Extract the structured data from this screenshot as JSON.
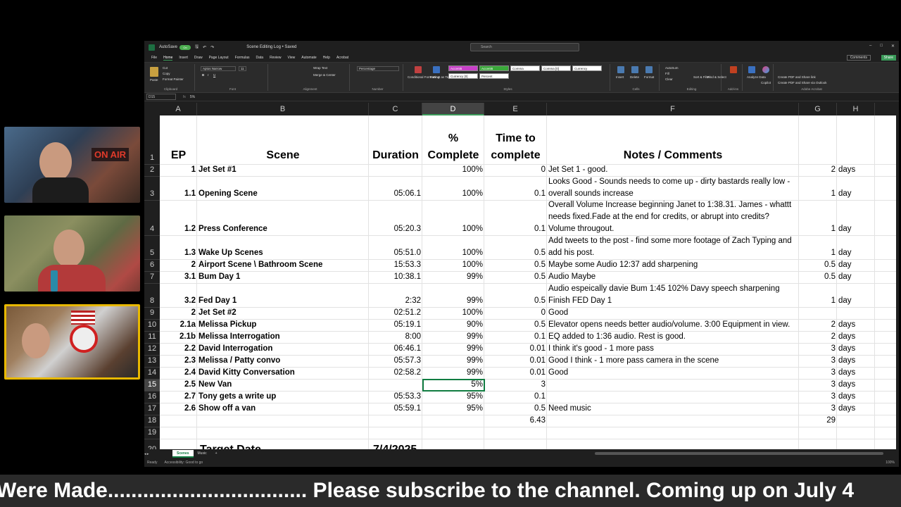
{
  "window": {
    "autosave_label": "AutoSave",
    "autosave_state": "On",
    "doc_title": "Scene Editing Log • Saved",
    "search_placeholder": "Search",
    "comments_label": "Comments",
    "share_label": "Share"
  },
  "menu": [
    "File",
    "Home",
    "Insert",
    "Draw",
    "Page Layout",
    "Formulas",
    "Data",
    "Review",
    "View",
    "Automate",
    "Help",
    "Acrobat"
  ],
  "ribbon": {
    "paste": "Paste",
    "cut": "Cut",
    "copy": "Copy",
    "format_painter": "Format Painter",
    "clipboard": "Clipboard",
    "font_name": "Aptos Narrow",
    "font_size": "11",
    "font": "Font",
    "wrap_text": "Wrap Text",
    "merge_center": "Merge & Center",
    "alignment": "Alignment",
    "number_format": "Percentage",
    "number": "Number",
    "conditional": "Conditional Formatting",
    "format_table": "Format as Table",
    "styles": "Styles",
    "style_cells": [
      "Accent6",
      "Accent6",
      "Comma",
      "Comma [0]",
      "Currency",
      "Currency [0]",
      "Percent"
    ],
    "insert": "Insert",
    "delete": "Delete",
    "format": "Format",
    "cells": "Cells",
    "autosum": "AutoSum",
    "fill": "Fill",
    "clear": "Clear",
    "sort_filter": "Sort & Filter",
    "find_select": "Find & Select",
    "editing": "Editing",
    "addins": "Add-ins",
    "analyze": "Analyze Data",
    "copilot": "Copilot",
    "create_pdf": "Create PDF and Share link",
    "create_pdf_outlook": "Create PDF and Share via Outlook",
    "adobe": "Adobe Acrobat"
  },
  "formula": {
    "namebox": "D15",
    "fx": "fx",
    "value": "5%"
  },
  "columns": [
    "A",
    "B",
    "C",
    "D",
    "E",
    "F",
    "G",
    "H"
  ],
  "headers": {
    "ep": "EP",
    "scene": "Scene",
    "duration": "Duration",
    "pct_line1": "%",
    "pct_line2": "Complete",
    "time_line1": "Time to",
    "time_line2": "complete",
    "notes": "Notes / Comments"
  },
  "rows": [
    {
      "num": "2",
      "ep": "1",
      "scene": "Jet Set #1",
      "duration": "",
      "pct": "100%",
      "time": "0",
      "notes": "Jet Set 1 - good.",
      "g": "2",
      "h": "days"
    },
    {
      "num": "3",
      "ep": "1.1",
      "scene": "Opening Scene",
      "duration": "05:06.1",
      "pct": "100%",
      "time": "0.1",
      "notes": "Looks Good - Sounds needs to come up - dirty bastards really low - overall sounds increase",
      "g": "1",
      "h": "day"
    },
    {
      "num": "4",
      "ep": "1.2",
      "scene": "Press Conference",
      "duration": "05:20.3",
      "pct": "100%",
      "time": "0.1",
      "notes": "Overall Volume Increase beginning Janet to 1:38.31. James - whattt needs fixed.Fade at the end for credits, or abrupt into credits? Volume througout.",
      "g": "1",
      "h": "day"
    },
    {
      "num": "5",
      "ep": "1.3",
      "scene": "Wake Up Scenes",
      "duration": "05:51.0",
      "pct": "100%",
      "time": "0.5",
      "notes": "Add tweets to the post - find some more footage of Zach Typing and add his post.",
      "g": "1",
      "h": "day"
    },
    {
      "num": "6",
      "ep": "2",
      "scene": "Airport Scene \\ Bathroom Scene",
      "duration": "15:53.3",
      "pct": "100%",
      "time": "0.5",
      "notes": "Maybe some Audio 12:37 add sharpening",
      "g": "0.5",
      "h": "day"
    },
    {
      "num": "7",
      "ep": "3.1",
      "scene": "Bum Day 1",
      "duration": "10:38.1",
      "pct": "99%",
      "time": "0.5",
      "notes": "Audio Maybe",
      "g": "0.5",
      "h": "day"
    },
    {
      "num": "8",
      "ep": "3.2",
      "scene": "Fed Day 1",
      "duration": "2:32",
      "pct": "99%",
      "time": "0.5",
      "notes": "Audio espeically davie Bum 1:45 102% Davy speech sharpening Finish FED Day 1",
      "g": "1",
      "h": "day"
    },
    {
      "num": "9",
      "ep": "2",
      "scene": "Jet Set #2",
      "duration": "02:51.2",
      "pct": "100%",
      "time": "0",
      "notes": "Good",
      "g": "",
      "h": ""
    },
    {
      "num": "10",
      "ep": "2.1a",
      "scene": "Melissa Pickup",
      "duration": "05:19.1",
      "pct": "90%",
      "time": "0.5",
      "notes": "Elevator opens needs better audio/volume. 3:00 Equipment in view.",
      "g": "2",
      "h": "days"
    },
    {
      "num": "11",
      "ep": "2.1b",
      "scene": "Melissa Interrogation",
      "duration": "8:00",
      "pct": "99%",
      "time": "0.1",
      "notes": "EQ added to 1:36 audio. Rest is good.",
      "g": "2",
      "h": "days"
    },
    {
      "num": "12",
      "ep": "2.2",
      "scene": "David Interrogation",
      "duration": "06:46.1",
      "pct": "99%",
      "time": "0.01",
      "notes": "I think it's good - 1 more pass",
      "g": "3",
      "h": "days"
    },
    {
      "num": "13",
      "ep": "2.3",
      "scene": "Melissa / Patty convo",
      "duration": "05:57.3",
      "pct": "99%",
      "time": "0.01",
      "notes": "Good I think - 1 more pass camera in the scene",
      "g": "3",
      "h": "days"
    },
    {
      "num": "14",
      "ep": "2.4",
      "scene": "David Kitty Conversation",
      "duration": "02:58.2",
      "pct": "99%",
      "time": "0.01",
      "notes": "Good",
      "g": "3",
      "h": "days"
    },
    {
      "num": "15",
      "ep": "2.5",
      "scene": "New Van",
      "duration": "",
      "pct": "5%",
      "time": "3",
      "notes": "",
      "g": "3",
      "h": "days"
    },
    {
      "num": "16",
      "ep": "2.7",
      "scene": "Tony gets a write up",
      "duration": "05:53.3",
      "pct": "95%",
      "time": "0.1",
      "notes": "",
      "g": "3",
      "h": "days"
    },
    {
      "num": "17",
      "ep": "2.6",
      "scene": "Show off a van",
      "duration": "05:59.1",
      "pct": "95%",
      "time": "0.5",
      "notes": "Need music",
      "g": "3",
      "h": "days"
    },
    {
      "num": "18",
      "ep": "",
      "scene": "",
      "duration": "",
      "pct": "",
      "time": "6.43",
      "notes": "",
      "g": "29",
      "h": ""
    },
    {
      "num": "19",
      "ep": "",
      "scene": "",
      "duration": "",
      "pct": "",
      "time": "",
      "notes": "",
      "g": "",
      "h": ""
    },
    {
      "num": "20",
      "ep": "",
      "scene": "Target Date",
      "duration": "7/4/2025",
      "pct": "",
      "time": "",
      "notes": "",
      "g": "",
      "h": ""
    }
  ],
  "sheets": [
    "Scenes",
    "Music"
  ],
  "status": {
    "ready": "Ready",
    "accessibility": "Accessibility: Good to go",
    "zoom": "100%"
  },
  "overlay": {
    "on_air": "ON AIR",
    "ticker": "Were Made.................................. Please subscribe to the channel.          Coming up on July 4"
  },
  "colors": {
    "excel_green": "#107c41",
    "ribbon_bg": "#2b2b2b",
    "cam_border": "#e8b800"
  }
}
